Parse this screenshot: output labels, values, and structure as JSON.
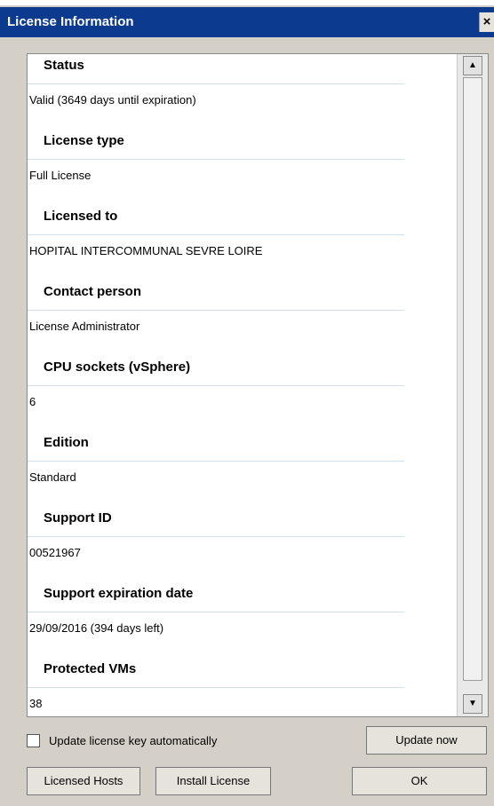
{
  "window": {
    "title": "License Information",
    "close_label": "×"
  },
  "sections": [
    {
      "heading": "Status",
      "value": "Valid  (3649 days until expiration)"
    },
    {
      "heading": "License type",
      "value": "Full License"
    },
    {
      "heading": "Licensed to",
      "value": "HOPITAL INTERCOMMUNAL SEVRE LOIRE"
    },
    {
      "heading": "Contact person",
      "value": "License Administrator"
    },
    {
      "heading": "CPU sockets (vSphere)",
      "value": "6"
    },
    {
      "heading": "Edition",
      "value": "Standard"
    },
    {
      "heading": "Support ID",
      "value": "00521967"
    },
    {
      "heading": "Support expiration date",
      "value": "29/09/2016 (394 days left)"
    },
    {
      "heading": "Protected VMs",
      "value": "38"
    }
  ],
  "scrollbar": {
    "up_icon": "▲",
    "down_icon": "▼"
  },
  "footer": {
    "auto_update_label": "Update license key automatically",
    "update_now_label": "Update now",
    "licensed_hosts_label": "Licensed Hosts",
    "install_license_label": "Install License",
    "ok_label": "OK"
  }
}
